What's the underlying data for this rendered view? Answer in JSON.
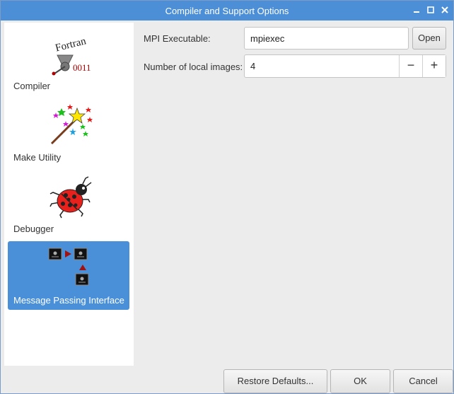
{
  "window": {
    "title": "Compiler and Support Options"
  },
  "sidebar": {
    "items": [
      {
        "label": "Compiler",
        "icon_text": "Fortran",
        "icon_digits": "0011"
      },
      {
        "label": "Make Utility"
      },
      {
        "label": "Debugger"
      },
      {
        "label": "Message Passing Interface",
        "selected": true
      }
    ]
  },
  "mpi": {
    "executable_label": "MPI Executable:",
    "executable_value": "mpiexec",
    "open_label": "Open",
    "images_label": "Number of local images:",
    "images_value": "4",
    "decrement_label": "−",
    "increment_label": "+"
  },
  "footer": {
    "restore_label": "Restore Defaults...",
    "ok_label": "OK",
    "cancel_label": "Cancel"
  },
  "colors": {
    "accent": "#4a90d9",
    "titlebar": "#4d8fd6"
  }
}
